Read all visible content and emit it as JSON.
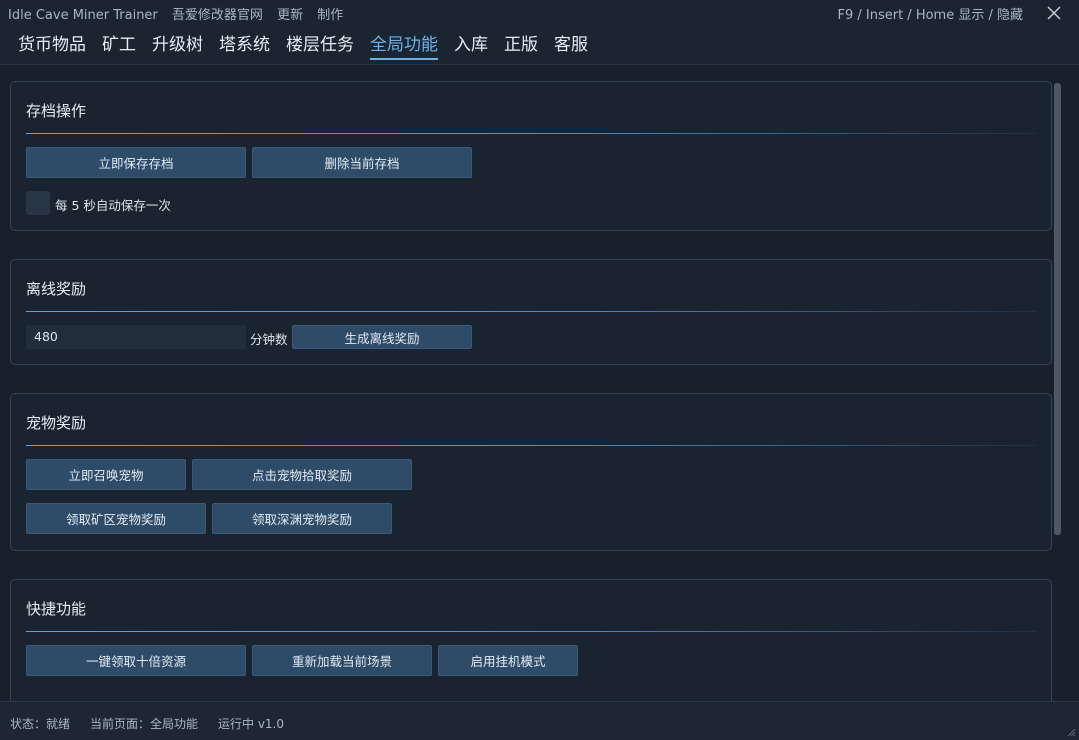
{
  "titlebar": {
    "app_title": "Idle Cave Miner Trainer",
    "links": [
      "吾爱修改器官网",
      "更新",
      "制作"
    ],
    "hotkey_hint": "F9 / Insert / Home  显示 / 隐藏",
    "close_icon": "close-icon"
  },
  "nav": {
    "tabs": [
      {
        "label": "货币物品",
        "active": false
      },
      {
        "label": "矿工",
        "active": false
      },
      {
        "label": "升级树",
        "active": false
      },
      {
        "label": "塔系统",
        "active": false
      },
      {
        "label": "楼层任务",
        "active": false
      },
      {
        "label": "全局功能",
        "active": true
      },
      {
        "label": "入库",
        "active": false
      },
      {
        "label": "正版",
        "active": false
      },
      {
        "label": "客服",
        "active": false
      }
    ]
  },
  "panels": {
    "save": {
      "title": "存档操作",
      "save_now": "立即保存存档",
      "delete_save": "删除当前存档",
      "autosave_label": "每 5 秒自动保存一次",
      "autosave_checked": false
    },
    "offline": {
      "title": "离线奖励",
      "minutes_value": "480",
      "minutes_unit": "分钟数",
      "generate": "生成离线奖励"
    },
    "pet": {
      "title": "宠物奖励",
      "summon": "立即召唤宠物",
      "click_collect": "点击宠物拾取奖励",
      "mine_reward": "领取矿区宠物奖励",
      "abyss_reward": "领取深渊宠物奖励"
    },
    "quick": {
      "title": "快捷功能",
      "ten_x": "一键领取十倍资源",
      "reload_scene": "重新加载当前场景",
      "idle_mode": "启用挂机模式"
    }
  },
  "status": {
    "state": "状态：就绪",
    "page": "当前页面：全局功能",
    "run": "运行中  v1.0"
  },
  "colors": {
    "accent": "#6ab2e7",
    "button": "#2e4b68",
    "background": "#1b2431"
  }
}
